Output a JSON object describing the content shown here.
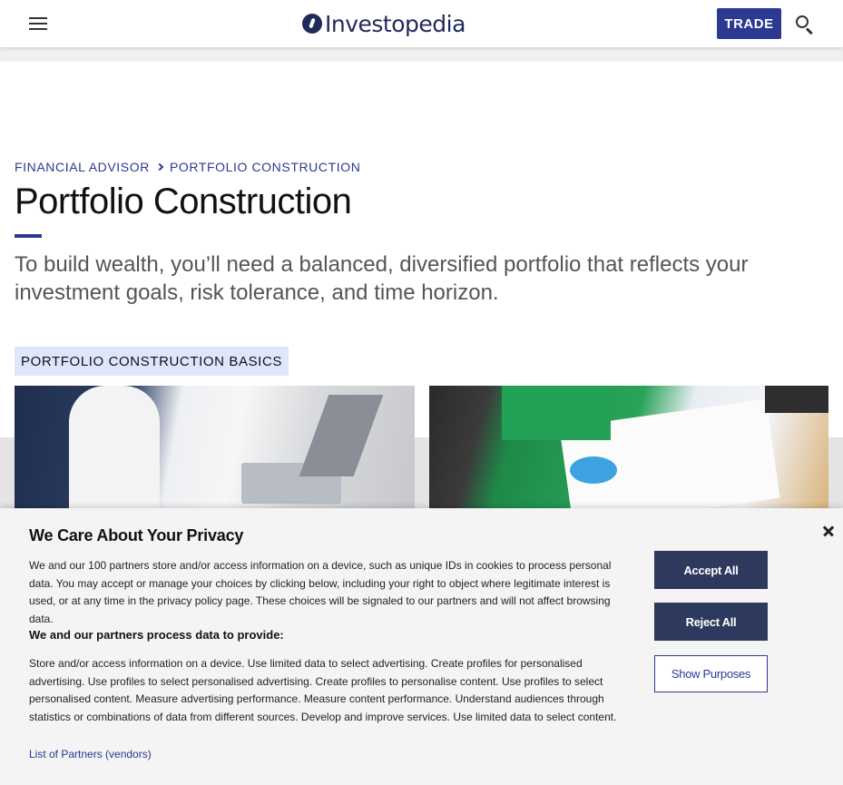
{
  "header": {
    "logo_text": "Investopedia",
    "trade_label": "TRADE"
  },
  "breadcrumb": {
    "items": [
      {
        "label": "FINANCIAL ADVISOR"
      },
      {
        "label": "PORTFOLIO CONSTRUCTION"
      }
    ]
  },
  "main": {
    "title": "Portfolio Construction",
    "subtitle": "To build wealth, you’ll need a balanced, diversified portfolio that reflects your investment goals, risk tolerance, and time horizon.",
    "section_label": "PORTFOLIO CONSTRUCTION BASICS"
  },
  "privacy": {
    "title": "We Care About Your Privacy",
    "text": "We and our 100 partners store and/or access information on a device, such as unique IDs in cookies to process personal data. You may accept or manage your choices by clicking below, including your right to object where legitimate interest is used, or at any time in the privacy policy page. These choices will be signaled to our partners and will not affect browsing data.",
    "subheading": "We and our partners process data to provide:",
    "purposes": "Store and/or access information on a device. Use limited data to select advertising. Create profiles for personalised advertising. Use profiles to select personalised advertising. Create profiles to personalise content. Use profiles to select personalised content. Measure advertising performance. Measure content performance. Understand audiences through statistics or combinations of data from different sources. Develop and improve services. Use limited data to select content.",
    "partners_link": "List of Partners (vendors)",
    "accept_label": "Accept All",
    "reject_label": "Reject All",
    "show_purposes_label": "Show Purposes"
  },
  "colors": {
    "brand": "#2b3990",
    "button_dark": "#2d3a5e",
    "section_label_bg": "#dde6fb"
  },
  "icons": {
    "menu": "hamburger-icon",
    "search": "search-icon",
    "close": "close-icon",
    "breadcrumb_separator": "chevron-right-icon"
  }
}
